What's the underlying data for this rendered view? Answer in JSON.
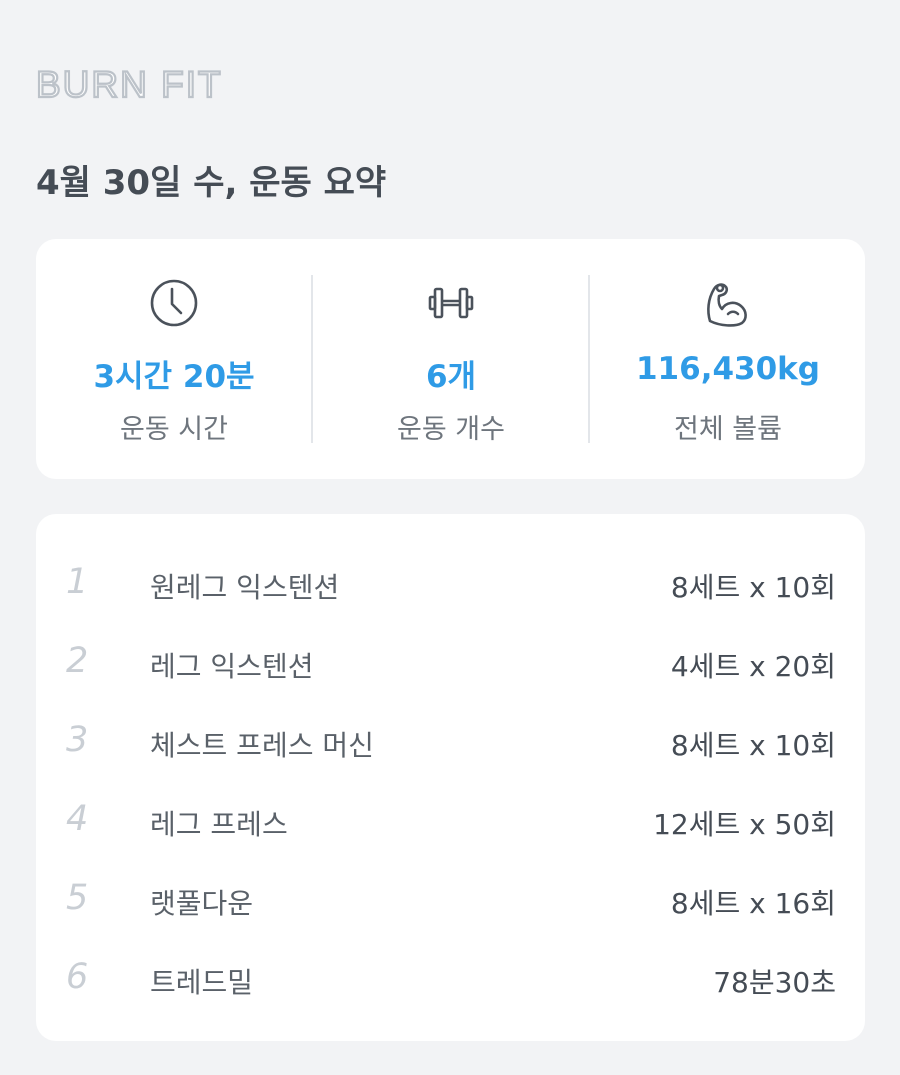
{
  "brand": {
    "logo_text": "BURN FIT"
  },
  "header": {
    "title": "4월 30일 수, 운동 요약"
  },
  "summary": {
    "stats": [
      {
        "icon": "clock-icon",
        "value": "3시간 20분",
        "label": "운동 시간"
      },
      {
        "icon": "dumbbell-icon",
        "value": "6개",
        "label": "운동 개수"
      },
      {
        "icon": "flexed-arm-icon",
        "value": "116,430kg",
        "label": "전체 볼륨"
      }
    ],
    "accent_color": "#2f9be6"
  },
  "exercises": [
    {
      "index": "1",
      "name": "원레그 익스텐션",
      "detail": "8세트 x 10회"
    },
    {
      "index": "2",
      "name": "레그 익스텐션",
      "detail": "4세트 x 20회"
    },
    {
      "index": "3",
      "name": "체스트 프레스 머신",
      "detail": "8세트 x 10회"
    },
    {
      "index": "4",
      "name": "레그 프레스",
      "detail": "12세트 x 50회"
    },
    {
      "index": "5",
      "name": "랫풀다운",
      "detail": "8세트 x 16회"
    },
    {
      "index": "6",
      "name": "트레드밀",
      "detail": "78분30초"
    }
  ]
}
